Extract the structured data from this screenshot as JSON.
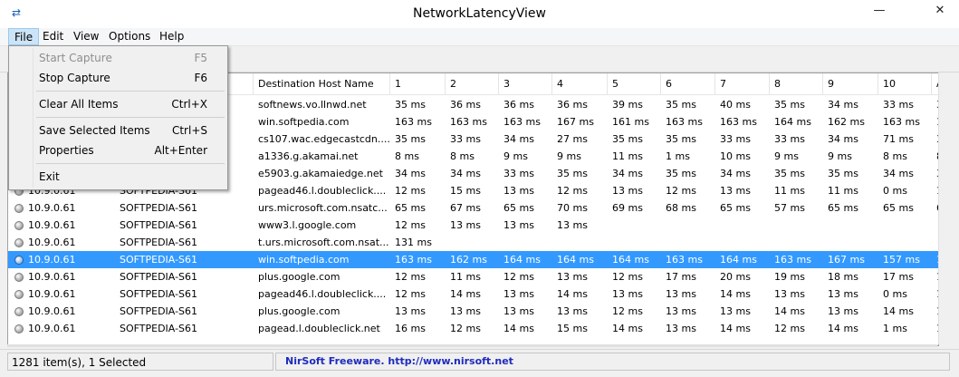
{
  "window": {
    "title": "NetworkLatencyView",
    "minimize": "—",
    "maximize": "☐",
    "close": "✕"
  },
  "menubar": [
    "File",
    "Edit",
    "View",
    "Options",
    "Help"
  ],
  "file_menu": [
    {
      "label": "Start Capture",
      "shortcut": "F5",
      "disabled": true
    },
    {
      "label": "Stop Capture",
      "shortcut": "F6",
      "disabled": false
    },
    {
      "label": "Clear All Items",
      "shortcut": "Ctrl+X",
      "disabled": false
    },
    {
      "label": "Save Selected Items",
      "shortcut": "Ctrl+S",
      "disabled": false
    },
    {
      "label": "Properties",
      "shortcut": "Alt+Enter",
      "disabled": false
    },
    {
      "label": "Exit",
      "shortcut": "",
      "disabled": false
    }
  ],
  "columns": [
    "",
    "",
    "Destination Host Name",
    "1",
    "2",
    "3",
    "4",
    "5",
    "6",
    "7",
    "8",
    "9",
    "10",
    "A"
  ],
  "rows": [
    {
      "ip": "",
      "computer": "",
      "host": "softnews.vo.llnwd.net",
      "v": [
        "35 ms",
        "36 ms",
        "36 ms",
        "36 ms",
        "39 ms",
        "35 ms",
        "40 ms",
        "35 ms",
        "34 ms",
        "33 ms",
        "3("
      ]
    },
    {
      "ip": "",
      "computer": "",
      "host": "win.softpedia.com",
      "v": [
        "163 ms",
        "163 ms",
        "163 ms",
        "167 ms",
        "161 ms",
        "163 ms",
        "163 ms",
        "164 ms",
        "162 ms",
        "163 ms",
        "16"
      ]
    },
    {
      "ip": "",
      "computer": "",
      "host": "cs107.wac.edgecastcdn....",
      "v": [
        "35 ms",
        "33 ms",
        "34 ms",
        "27 ms",
        "35 ms",
        "35 ms",
        "33 ms",
        "33 ms",
        "34 ms",
        "71 ms",
        "3("
      ]
    },
    {
      "ip": "",
      "computer": "",
      "host": "a1336.g.akamai.net",
      "v": [
        "8 ms",
        "8 ms",
        "9 ms",
        "9 ms",
        "11 ms",
        "1 ms",
        "10 ms",
        "9 ms",
        "9 ms",
        "8 ms",
        "8"
      ]
    },
    {
      "ip": "",
      "computer": "",
      "host": "e5903.g.akamaiedge.net",
      "v": [
        "34 ms",
        "34 ms",
        "33 ms",
        "35 ms",
        "34 ms",
        "35 ms",
        "34 ms",
        "35 ms",
        "35 ms",
        "34 ms",
        "3("
      ]
    },
    {
      "ip": "10.9.0.61",
      "computer": "SOFTPEDIA-S61",
      "host": "pagead46.l.doubleclick....",
      "v": [
        "12 ms",
        "15 ms",
        "13 ms",
        "12 ms",
        "13 ms",
        "12 ms",
        "13 ms",
        "11 ms",
        "11 ms",
        "0 ms",
        "1"
      ]
    },
    {
      "ip": "10.9.0.61",
      "computer": "SOFTPEDIA-S61",
      "host": "urs.microsoft.com.nsatc...",
      "v": [
        "65 ms",
        "67 ms",
        "65 ms",
        "70 ms",
        "69 ms",
        "68 ms",
        "65 ms",
        "57 ms",
        "65 ms",
        "65 ms",
        "6"
      ]
    },
    {
      "ip": "10.9.0.61",
      "computer": "SOFTPEDIA-S61",
      "host": "www3.l.google.com",
      "v": [
        "12 ms",
        "13 ms",
        "13 ms",
        "13 ms",
        "",
        "",
        "",
        "",
        "",
        "",
        ""
      ]
    },
    {
      "ip": "10.9.0.61",
      "computer": "SOFTPEDIA-S61",
      "host": "t.urs.microsoft.com.nsat...",
      "v": [
        "131 ms",
        "",
        "",
        "",
        "",
        "",
        "",
        "",
        "",
        "",
        ""
      ]
    },
    {
      "ip": "10.9.0.61",
      "computer": "SOFTPEDIA-S61",
      "host": "win.softpedia.com",
      "v": [
        "163 ms",
        "162 ms",
        "164 ms",
        "164 ms",
        "164 ms",
        "163 ms",
        "164 ms",
        "163 ms",
        "167 ms",
        "157 ms",
        "1"
      ],
      "selected": true
    },
    {
      "ip": "10.9.0.61",
      "computer": "SOFTPEDIA-S61",
      "host": "plus.google.com",
      "v": [
        "12 ms",
        "11 ms",
        "12 ms",
        "13 ms",
        "12 ms",
        "17 ms",
        "20 ms",
        "19 ms",
        "18 ms",
        "17 ms",
        "1"
      ]
    },
    {
      "ip": "10.9.0.61",
      "computer": "SOFTPEDIA-S61",
      "host": "pagead46.l.doubleclick....",
      "v": [
        "12 ms",
        "14 ms",
        "13 ms",
        "14 ms",
        "13 ms",
        "13 ms",
        "14 ms",
        "13 ms",
        "13 ms",
        "0 ms",
        "1"
      ]
    },
    {
      "ip": "10.9.0.61",
      "computer": "SOFTPEDIA-S61",
      "host": "plus.google.com",
      "v": [
        "13 ms",
        "13 ms",
        "13 ms",
        "13 ms",
        "12 ms",
        "13 ms",
        "13 ms",
        "14 ms",
        "13 ms",
        "14 ms",
        "1"
      ]
    },
    {
      "ip": "10.9.0.61",
      "computer": "SOFTPEDIA-S61",
      "host": "pagead.l.doubleclick.net",
      "v": [
        "16 ms",
        "12 ms",
        "14 ms",
        "15 ms",
        "14 ms",
        "13 ms",
        "14 ms",
        "12 ms",
        "14 ms",
        "1 ms",
        "1"
      ]
    }
  ],
  "status": {
    "count": "1281 item(s), 1 Selected",
    "credit": "NirSoft Freeware.  http://www.nirsoft.net"
  }
}
